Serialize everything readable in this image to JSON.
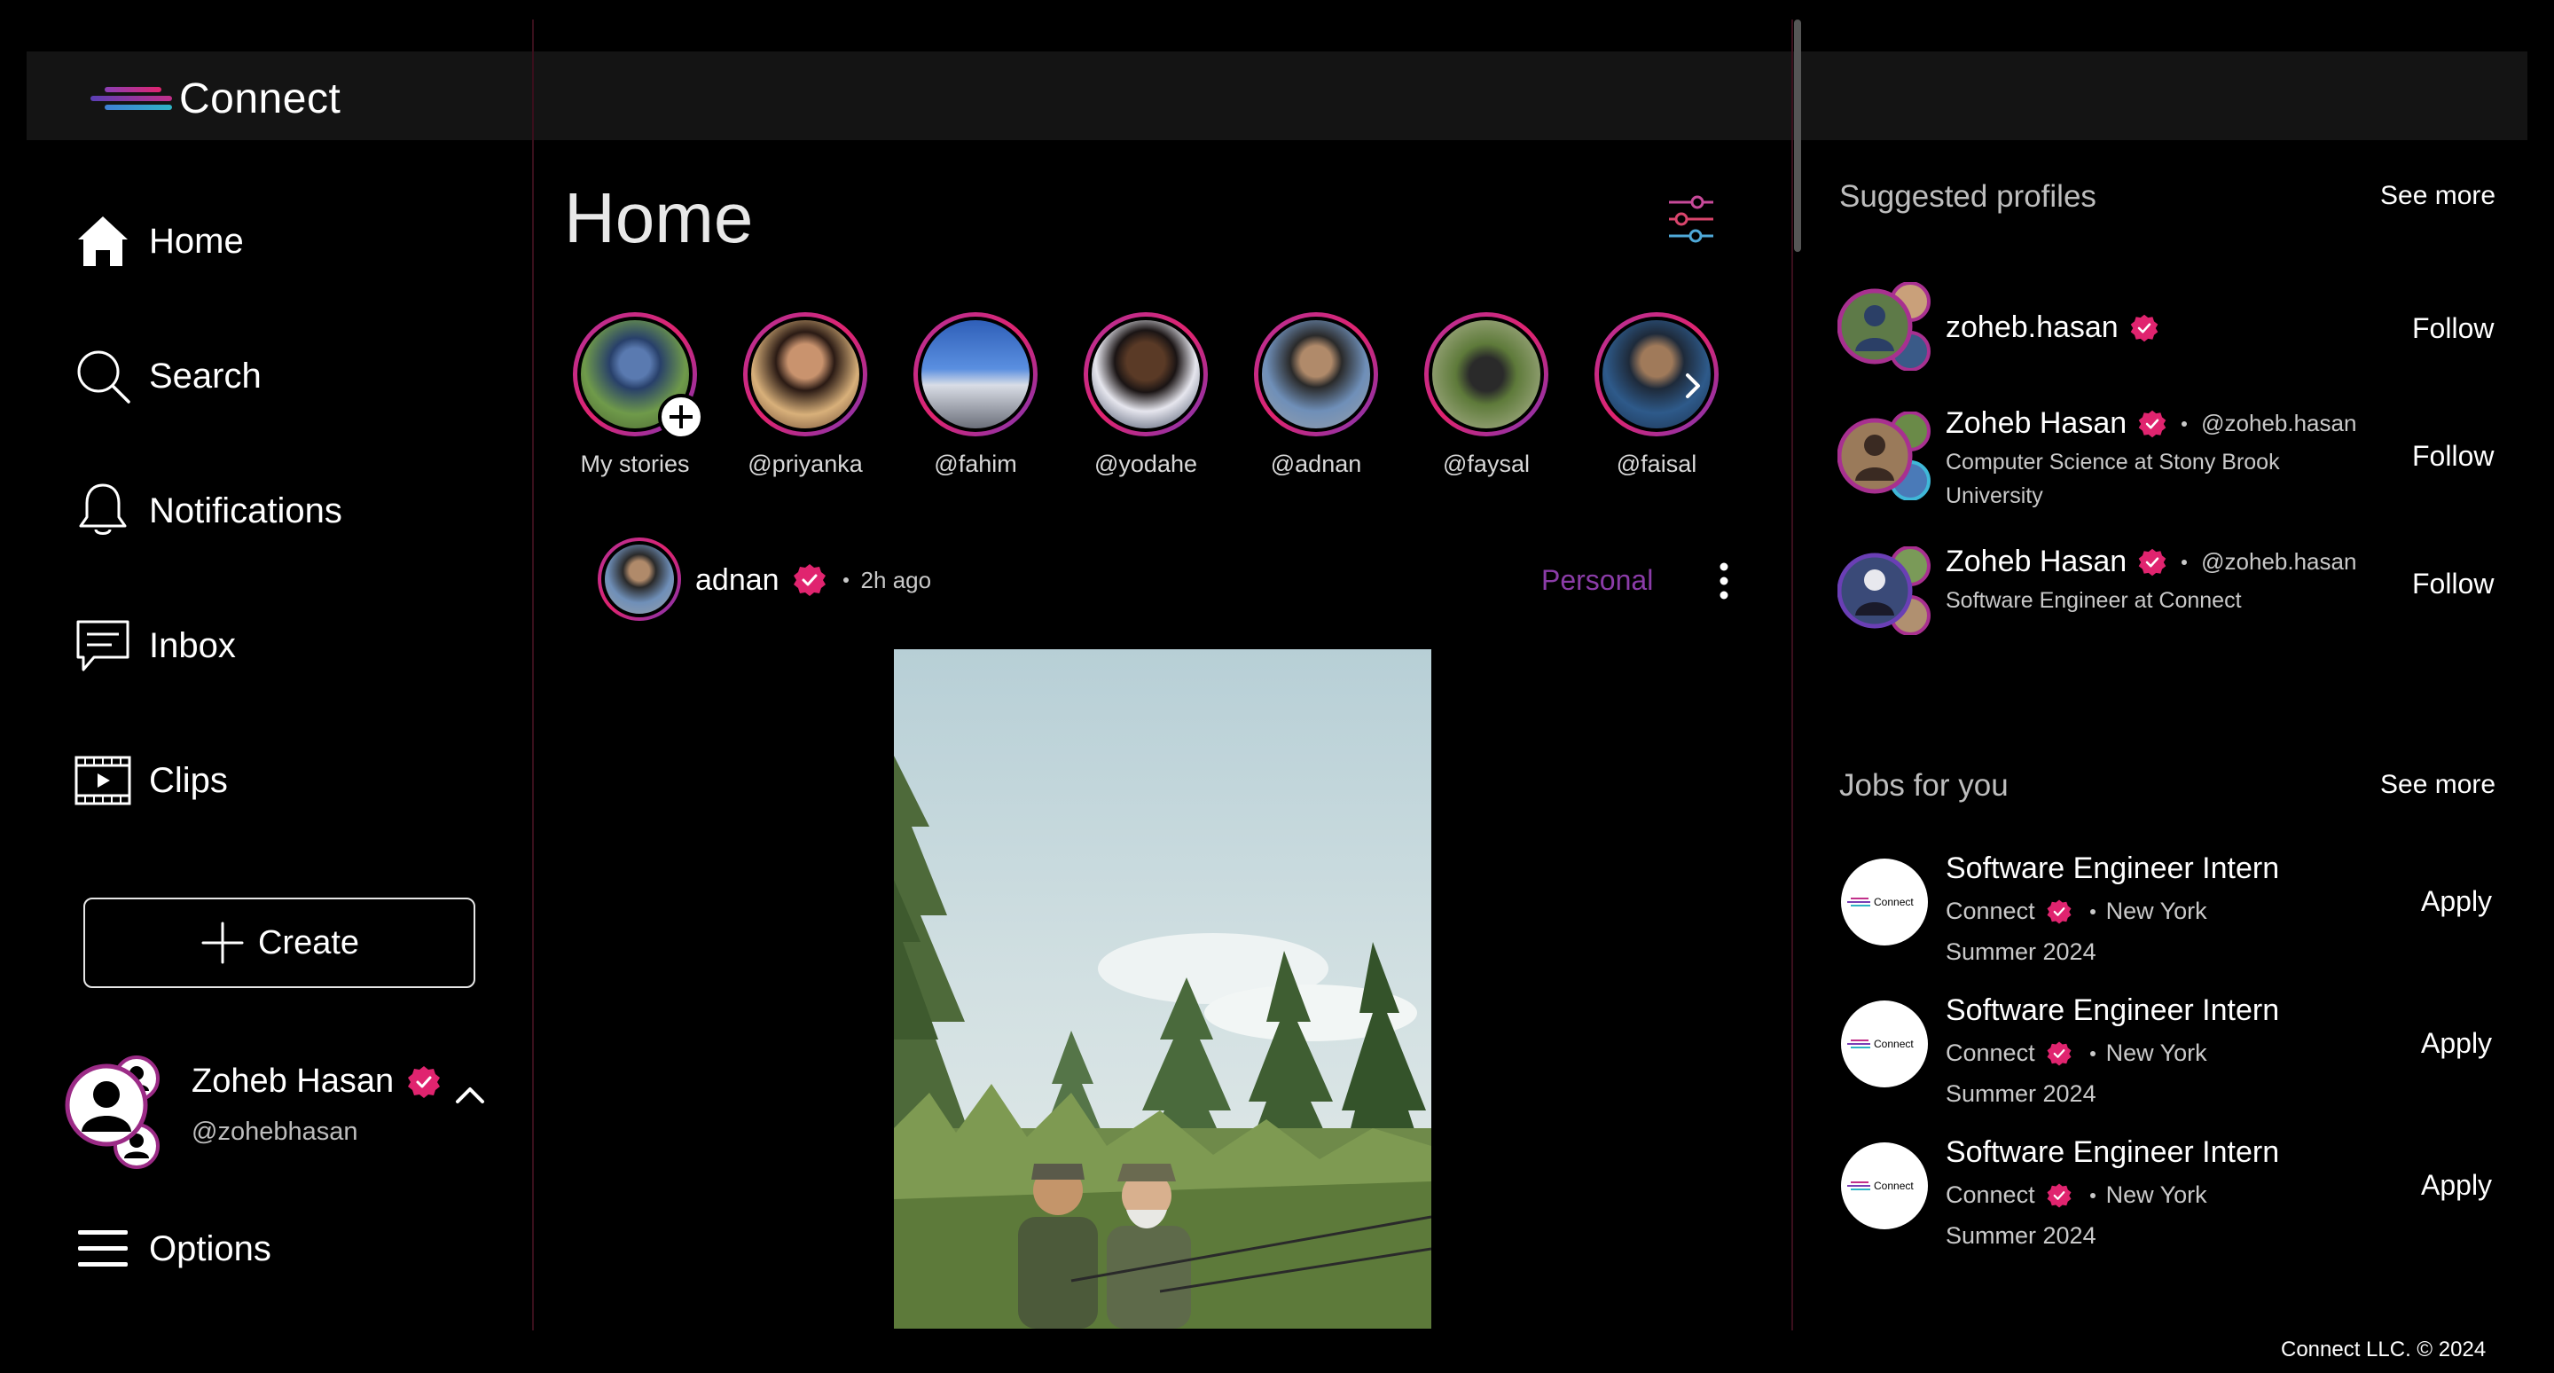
{
  "app": {
    "name": "Connect"
  },
  "nav": {
    "items": [
      {
        "label": "Home",
        "icon": "home-icon"
      },
      {
        "label": "Search",
        "icon": "search-icon"
      },
      {
        "label": "Notifications",
        "icon": "bell-icon"
      },
      {
        "label": "Inbox",
        "icon": "chat-icon"
      },
      {
        "label": "Clips",
        "icon": "film-icon"
      }
    ],
    "create_label": "Create",
    "options_label": "Options"
  },
  "me": {
    "name": "Zoheb Hasan",
    "handle": "@zohebhasan"
  },
  "main": {
    "title": "Home",
    "stories": [
      {
        "label": "My stories"
      },
      {
        "label": "@priyanka"
      },
      {
        "label": "@fahim"
      },
      {
        "label": "@yodahe"
      },
      {
        "label": "@adnan"
      },
      {
        "label": "@faysal"
      },
      {
        "label": "@faisal"
      }
    ],
    "post": {
      "author": "adnan",
      "time": "2h ago",
      "category": "Personal"
    }
  },
  "suggested": {
    "title": "Suggested profiles",
    "see_more": "See more",
    "profiles": [
      {
        "name": "zoheb.hasan",
        "handle": "",
        "sub": "",
        "action": "Follow"
      },
      {
        "name": "Zoheb Hasan",
        "handle": "@zoheb.hasan",
        "sub": "Computer Science at Stony Brook University",
        "action": "Follow"
      },
      {
        "name": "Zoheb Hasan",
        "handle": "@zoheb.hasan",
        "sub": "Software Engineer at Connect",
        "action": "Follow"
      }
    ]
  },
  "jobs": {
    "title": "Jobs for you",
    "see_more": "See more",
    "items": [
      {
        "title": "Software Engineer Intern",
        "company": "Connect",
        "location": "New York",
        "term": "Summer 2024",
        "action": "Apply",
        "logo_text": "Connect"
      },
      {
        "title": "Software Engineer Intern",
        "company": "Connect",
        "location": "New York",
        "term": "Summer 2024",
        "action": "Apply",
        "logo_text": "Connect"
      },
      {
        "title": "Software Engineer Intern",
        "company": "Connect",
        "location": "New York",
        "term": "Summer 2024",
        "action": "Apply",
        "logo_text": "Connect"
      }
    ]
  },
  "footer": "Connect LLC. © 2024",
  "colors": {
    "accent": "#e0246f",
    "verified": "#e0246f",
    "category": "#8b3ca8",
    "topbar": "#141414"
  }
}
